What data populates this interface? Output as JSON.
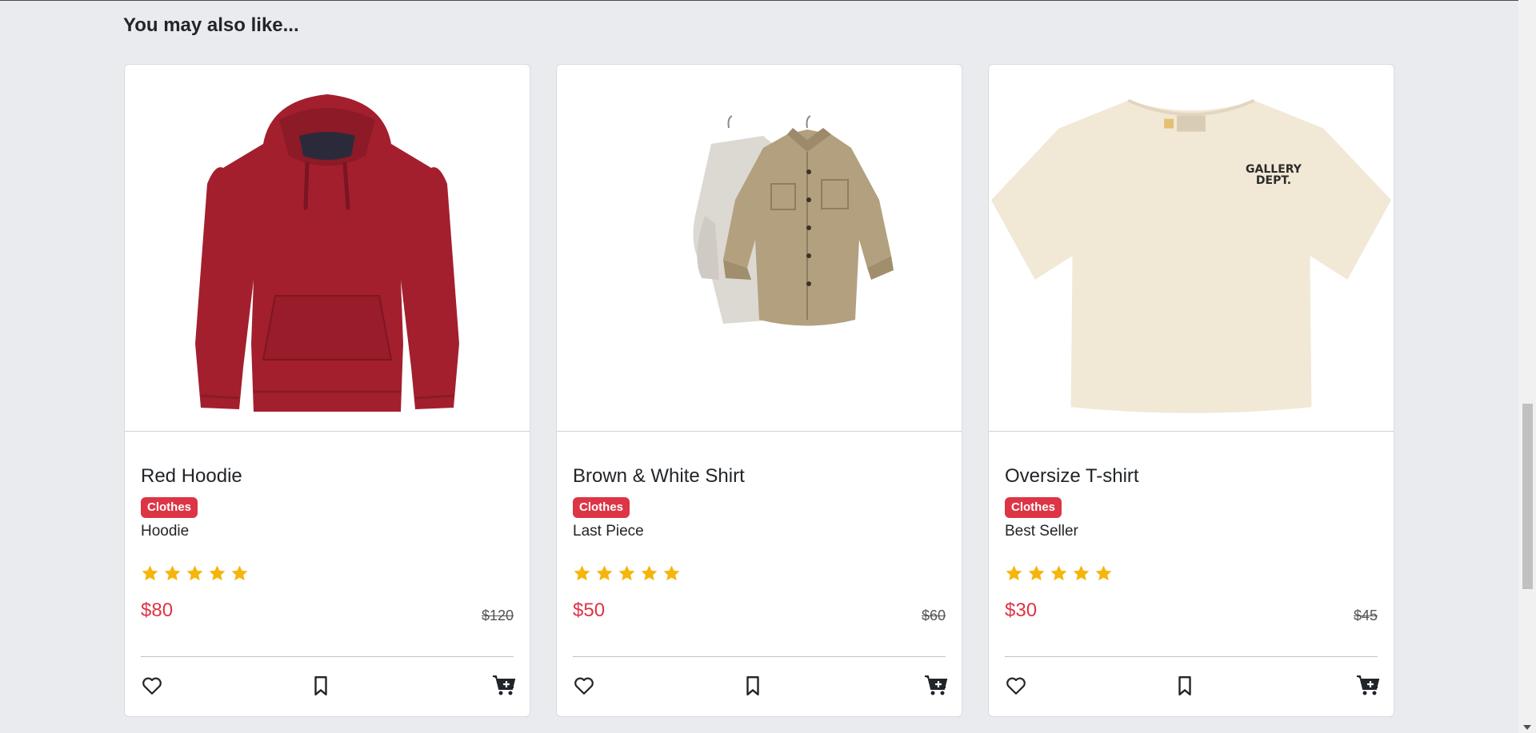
{
  "section": {
    "title": "You may also like..."
  },
  "products": [
    {
      "name": "Red Hoodie",
      "category": "Clothes",
      "tagline": "Hoodie",
      "rating": 5,
      "price": "$80",
      "old_price": "$120",
      "image": "red-hoodie-image"
    },
    {
      "name": "Brown & White Shirt",
      "category": "Clothes",
      "tagline": "Last Piece",
      "rating": 5,
      "price": "$50",
      "old_price": "$60",
      "image": "shirts-on-hangers-image"
    },
    {
      "name": "Oversize T-shirt",
      "category": "Clothes",
      "tagline": "Best Seller",
      "rating": 5,
      "price": "$30",
      "old_price": "$45",
      "image": "cream-tshirt-image",
      "print_text": "GALLERY DEPT."
    }
  ],
  "icons": {
    "wishlist": "heart-icon",
    "save": "bookmark-icon",
    "add_to_cart": "cart-plus-icon",
    "rating_star": "star-icon"
  },
  "colors": {
    "background": "#e9ebef",
    "badge": "#dc3545",
    "price": "#dc3545",
    "star": "#f5b50a"
  }
}
